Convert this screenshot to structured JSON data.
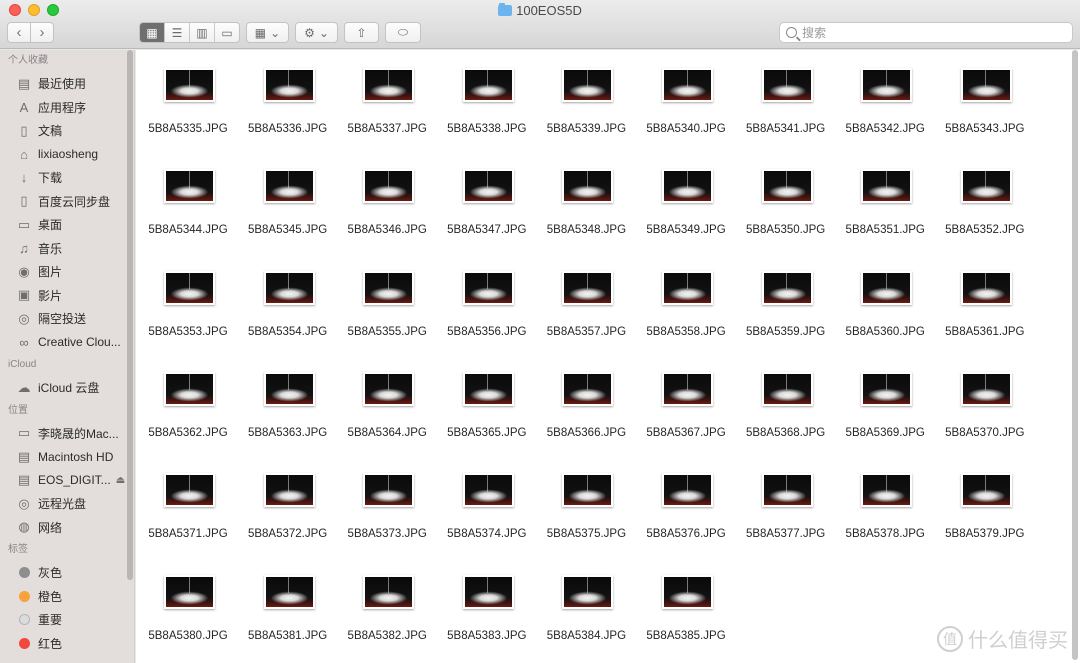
{
  "window": {
    "title": "100EOS5D"
  },
  "toolbar": {
    "back_glyph": "‹",
    "forward_glyph": "›",
    "view_glyphs": [
      "▦",
      "☰",
      "▥",
      "▭"
    ],
    "arrange_glyph": "▦",
    "action_glyph": "⚙",
    "dropdown_glyph": "⌄",
    "share_glyph": "⇧",
    "tag_glyph": "⬭"
  },
  "search": {
    "placeholder": "搜索"
  },
  "sidebar": {
    "favorites_header": "个人收藏",
    "favorites": [
      {
        "label": "最近使用",
        "icon": "recents-icon",
        "glyph": "▤"
      },
      {
        "label": "应用程序",
        "icon": "applications-icon",
        "glyph": "A"
      },
      {
        "label": "文稿",
        "icon": "documents-icon",
        "glyph": "▯"
      },
      {
        "label": "lixiaosheng",
        "icon": "home-icon",
        "glyph": "⌂"
      },
      {
        "label": "下载",
        "icon": "downloads-icon",
        "glyph": "↓"
      },
      {
        "label": "百度云同步盘",
        "icon": "folder-icon",
        "glyph": "▯"
      },
      {
        "label": "桌面",
        "icon": "desktop-icon",
        "glyph": "▭"
      },
      {
        "label": "音乐",
        "icon": "music-icon",
        "glyph": "♫"
      },
      {
        "label": "图片",
        "icon": "camera-icon",
        "glyph": "◉"
      },
      {
        "label": "影片",
        "icon": "movies-icon",
        "glyph": "▣"
      },
      {
        "label": "隔空投送",
        "icon": "airdrop-icon",
        "glyph": "◎"
      },
      {
        "label": "Creative Clou...",
        "icon": "creative-cloud-icon",
        "glyph": "∞"
      }
    ],
    "icloud_header": "iCloud",
    "icloud": [
      {
        "label": "iCloud 云盘",
        "icon": "cloud-icon",
        "glyph": "☁"
      }
    ],
    "locations_header": "位置",
    "locations": [
      {
        "label": "李晓晟的Mac...",
        "icon": "laptop-icon",
        "glyph": "▭"
      },
      {
        "label": "Macintosh HD",
        "icon": "disk-icon",
        "glyph": "▤"
      },
      {
        "label": "EOS_DIGIT...",
        "icon": "sd-card-icon",
        "glyph": "▤",
        "eject": "⏏"
      },
      {
        "label": "远程光盘",
        "icon": "disc-icon",
        "glyph": "◎"
      },
      {
        "label": "网络",
        "icon": "network-icon",
        "glyph": "◍"
      }
    ],
    "tags_header": "标签",
    "tags": [
      {
        "label": "灰色",
        "color": "#8e8e8e"
      },
      {
        "label": "橙色",
        "color": "#f7a23b"
      },
      {
        "label": "重要",
        "color": "#dcdcdc"
      },
      {
        "label": "红色",
        "color": "#f0473f"
      }
    ]
  },
  "files": [
    "5B8A5335.JPG",
    "5B8A5336.JPG",
    "5B8A5337.JPG",
    "5B8A5338.JPG",
    "5B8A5339.JPG",
    "5B8A5340.JPG",
    "5B8A5341.JPG",
    "5B8A5342.JPG",
    "5B8A5343.JPG",
    "5B8A5344.JPG",
    "5B8A5345.JPG",
    "5B8A5346.JPG",
    "5B8A5347.JPG",
    "5B8A5348.JPG",
    "5B8A5349.JPG",
    "5B8A5350.JPG",
    "5B8A5351.JPG",
    "5B8A5352.JPG",
    "5B8A5353.JPG",
    "5B8A5354.JPG",
    "5B8A5355.JPG",
    "5B8A5356.JPG",
    "5B8A5357.JPG",
    "5B8A5358.JPG",
    "5B8A5359.JPG",
    "5B8A5360.JPG",
    "5B8A5361.JPG",
    "5B8A5362.JPG",
    "5B8A5363.JPG",
    "5B8A5364.JPG",
    "5B8A5365.JPG",
    "5B8A5366.JPG",
    "5B8A5367.JPG",
    "5B8A5368.JPG",
    "5B8A5369.JPG",
    "5B8A5370.JPG",
    "5B8A5371.JPG",
    "5B8A5372.JPG",
    "5B8A5373.JPG",
    "5B8A5374.JPG",
    "5B8A5375.JPG",
    "5B8A5376.JPG",
    "5B8A5377.JPG",
    "5B8A5378.JPG",
    "5B8A5379.JPG",
    "5B8A5380.JPG",
    "5B8A5381.JPG",
    "5B8A5382.JPG",
    "5B8A5383.JPG",
    "5B8A5384.JPG",
    "5B8A5385.JPG"
  ],
  "watermark": {
    "text": "什么值得买",
    "glyph": "值"
  }
}
